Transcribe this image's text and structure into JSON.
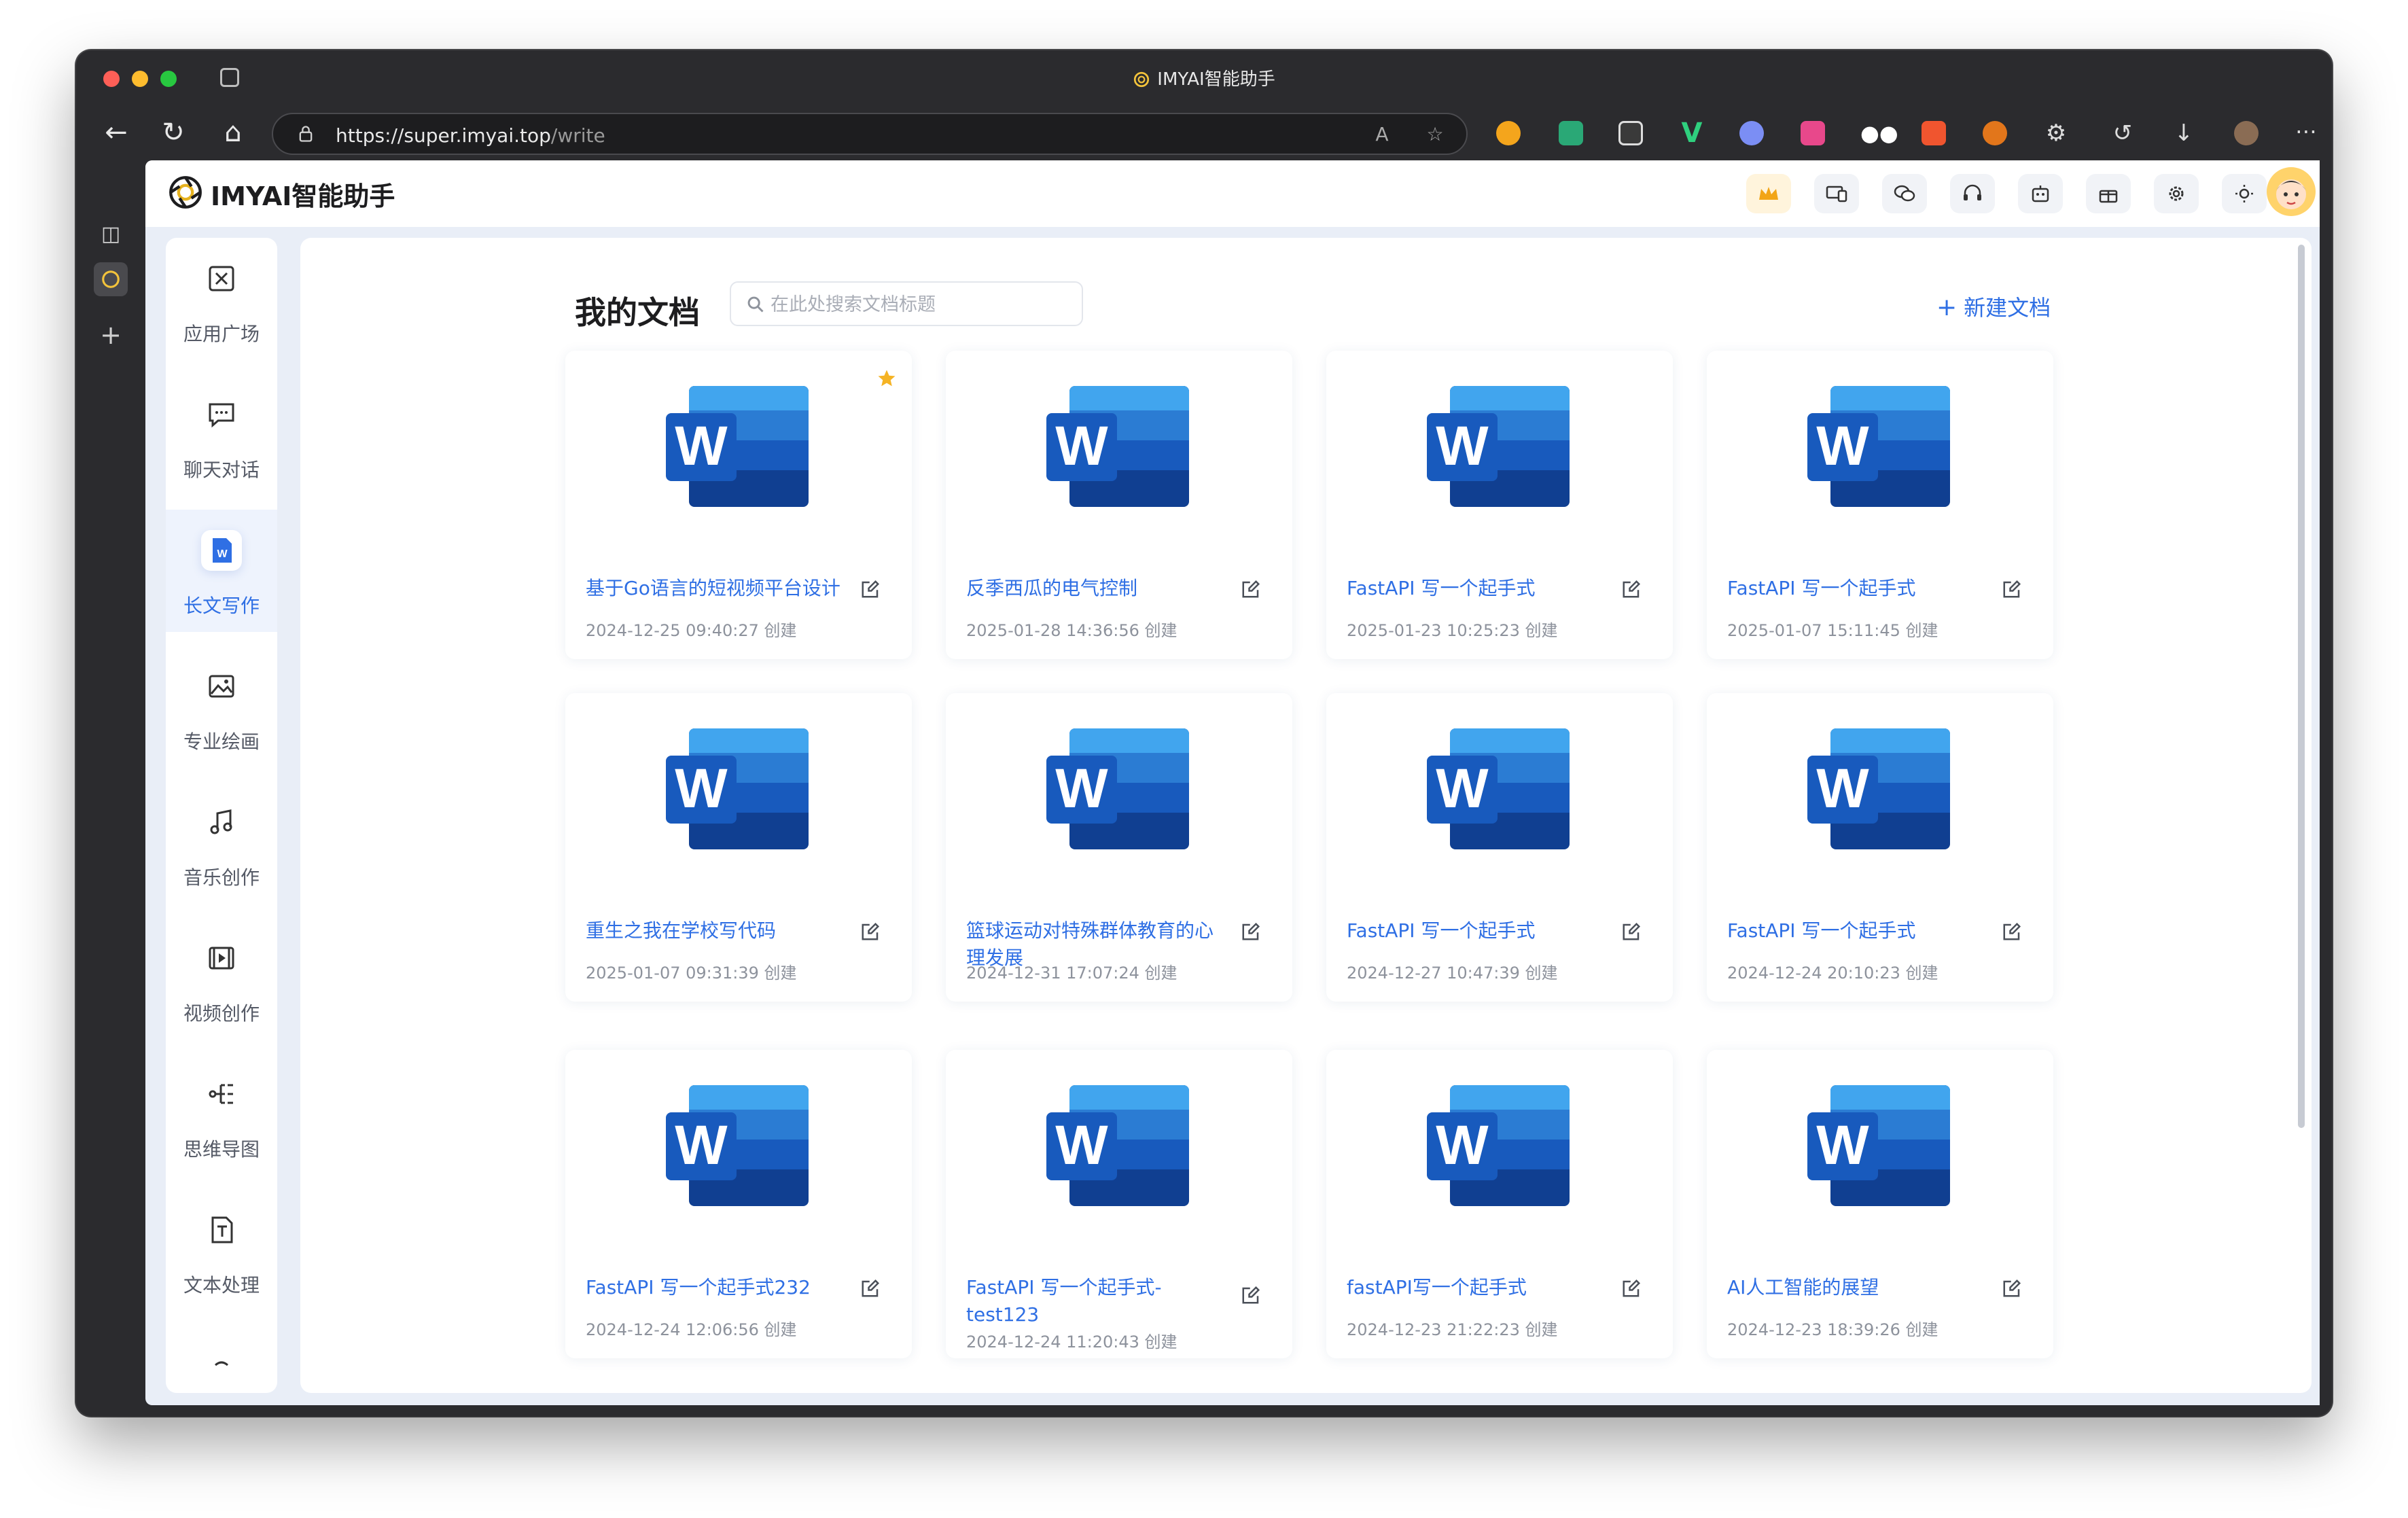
{
  "browser": {
    "window_title": "IMYAI智能助手",
    "url_host": "https://super.imyai.top",
    "url_path": "/write"
  },
  "app": {
    "brand": "IMYAI智能助手"
  },
  "nav": {
    "items": [
      {
        "label": "应用广场",
        "icon": "grid-icon"
      },
      {
        "label": "聊天对话",
        "icon": "chat-icon"
      },
      {
        "label": "长文写作",
        "icon": "word-doc-icon",
        "active": true
      },
      {
        "label": "专业绘画",
        "icon": "image-icon"
      },
      {
        "label": "音乐创作",
        "icon": "music-icon"
      },
      {
        "label": "视频创作",
        "icon": "video-icon"
      },
      {
        "label": "思维导图",
        "icon": "mindmap-icon"
      },
      {
        "label": "文本处理",
        "icon": "text-icon"
      }
    ]
  },
  "main": {
    "title": "我的文档",
    "search_placeholder": "在此处搜索文档标题",
    "new_doc_label": "新建文档",
    "docs": [
      {
        "name": "基于Go语言的短视频平台设计",
        "date": "2024-12-25 09:40:27 创建",
        "starred": true
      },
      {
        "name": "反季西瓜的电气控制",
        "date": "2025-01-28 14:36:56 创建"
      },
      {
        "name": "FastAPI 写一个起手式",
        "date": "2025-01-23 10:25:23 创建"
      },
      {
        "name": "FastAPI 写一个起手式",
        "date": "2025-01-07 15:11:45 创建"
      },
      {
        "name": "重生之我在学校写代码",
        "date": "2025-01-07 09:31:39 创建"
      },
      {
        "name": "篮球运动对特殊群体教育的心理发展",
        "date": "2024-12-31 17:07:24 创建"
      },
      {
        "name": "FastAPI 写一个起手式",
        "date": "2024-12-27 10:47:39 创建"
      },
      {
        "name": "FastAPI 写一个起手式",
        "date": "2024-12-24 20:10:23 创建"
      },
      {
        "name": "FastAPI 写一个起手式232",
        "date": "2024-12-24 12:06:56 创建"
      },
      {
        "name": "FastAPI 写一个起手式-test123",
        "date": "2024-12-24 11:20:43 创建"
      },
      {
        "name": "fastAPI写一个起手式",
        "date": "2024-12-23 21:22:23 创建"
      },
      {
        "name": "AI人工智能的展望",
        "date": "2024-12-23 18:39:26 创建"
      }
    ]
  },
  "colors": {
    "accent": "#2f6fe4",
    "word_blue_dark": "#103f91",
    "word_blue": "#185abd",
    "star": "#f5b324"
  }
}
